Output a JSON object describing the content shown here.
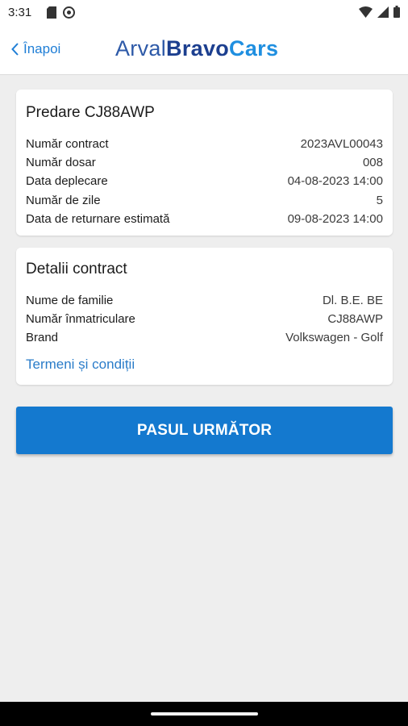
{
  "status_bar": {
    "time": "3:31",
    "left_icons": [
      "sim-card-icon",
      "cloud-sync-icon"
    ],
    "right_icons": [
      "wifi-icon",
      "cellular-signal-icon",
      "battery-icon"
    ]
  },
  "header": {
    "back_label": "Înapoi",
    "logo": {
      "part1": "Arval",
      "part2": "Bravo",
      "part3": "Cars"
    }
  },
  "handover_card": {
    "title": "Predare CJ88AWP",
    "rows": [
      {
        "label": "Număr contract",
        "value": "2023AVL00043"
      },
      {
        "label": "Număr dosar",
        "value": "008"
      },
      {
        "label": "Data deplecare",
        "value": "04-08-2023 14:00"
      },
      {
        "label": "Număr de zile",
        "value": "5"
      },
      {
        "label": "Data de returnare estimată",
        "value": "09-08-2023 14:00"
      }
    ]
  },
  "contract_card": {
    "title": "Detalii contract",
    "rows": [
      {
        "label": "Nume de familie",
        "value": "Dl. B.E. BE"
      },
      {
        "label": "Număr înmatriculare",
        "value": "CJ88AWP"
      },
      {
        "label": "Brand",
        "value": "Volkswagen - Golf"
      }
    ],
    "terms_link": "Termeni și condiții"
  },
  "next_button": "PASUL URMĂTOR",
  "colors": {
    "accent": "#1479cf",
    "link": "#2a7cc9",
    "background": "#eeeeee"
  }
}
